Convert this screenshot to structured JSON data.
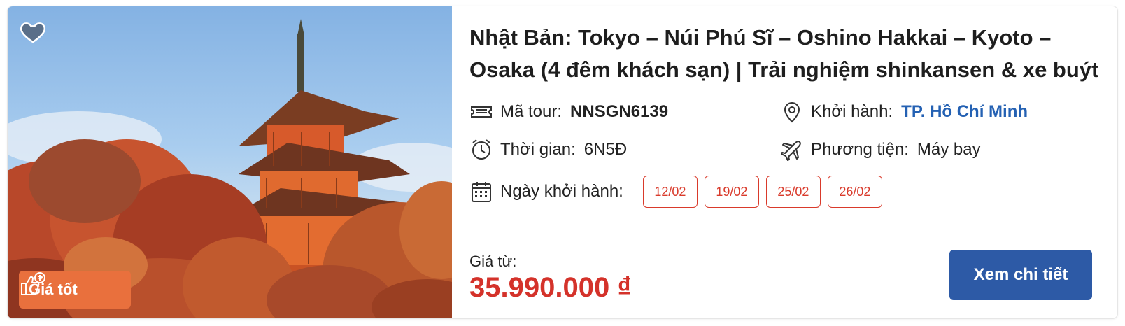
{
  "tour": {
    "title": "Nhật Bản: Tokyo – Núi Phú Sĩ – Oshino Hakkai – Kyoto – Osaka (4 đêm khách sạn) | Trải nghiệm shinkansen & xe buýt",
    "badge_label": "Giá tốt",
    "code_label": "Mã tour:",
    "code_value": "NNSGN6139",
    "departure_label": "Khởi hành:",
    "departure_value": "TP. Hồ Chí Minh",
    "duration_label": "Thời gian:",
    "duration_value": "6N5Đ",
    "transport_label": "Phương tiện:",
    "transport_value": "Máy bay",
    "dates_label": "Ngày khởi hành:",
    "dates": [
      "12/02",
      "19/02",
      "25/02",
      "26/02"
    ],
    "price_label": "Giá từ:",
    "price_value": "35.990.000 ₫",
    "cta_label": "Xem chi tiết"
  },
  "icons": {
    "favorite": "heart-icon",
    "badge": "thumbs-up-money-icon",
    "code": "ticket-icon",
    "departure": "location-pin-icon",
    "duration": "alarm-clock-icon",
    "transport": "airplane-icon",
    "dates": "calendar-icon"
  },
  "colors": {
    "accent_red": "#d4322a",
    "badge_orange": "#e9703d",
    "button_blue": "#2d5aa6",
    "link_blue": "#2461b3"
  }
}
